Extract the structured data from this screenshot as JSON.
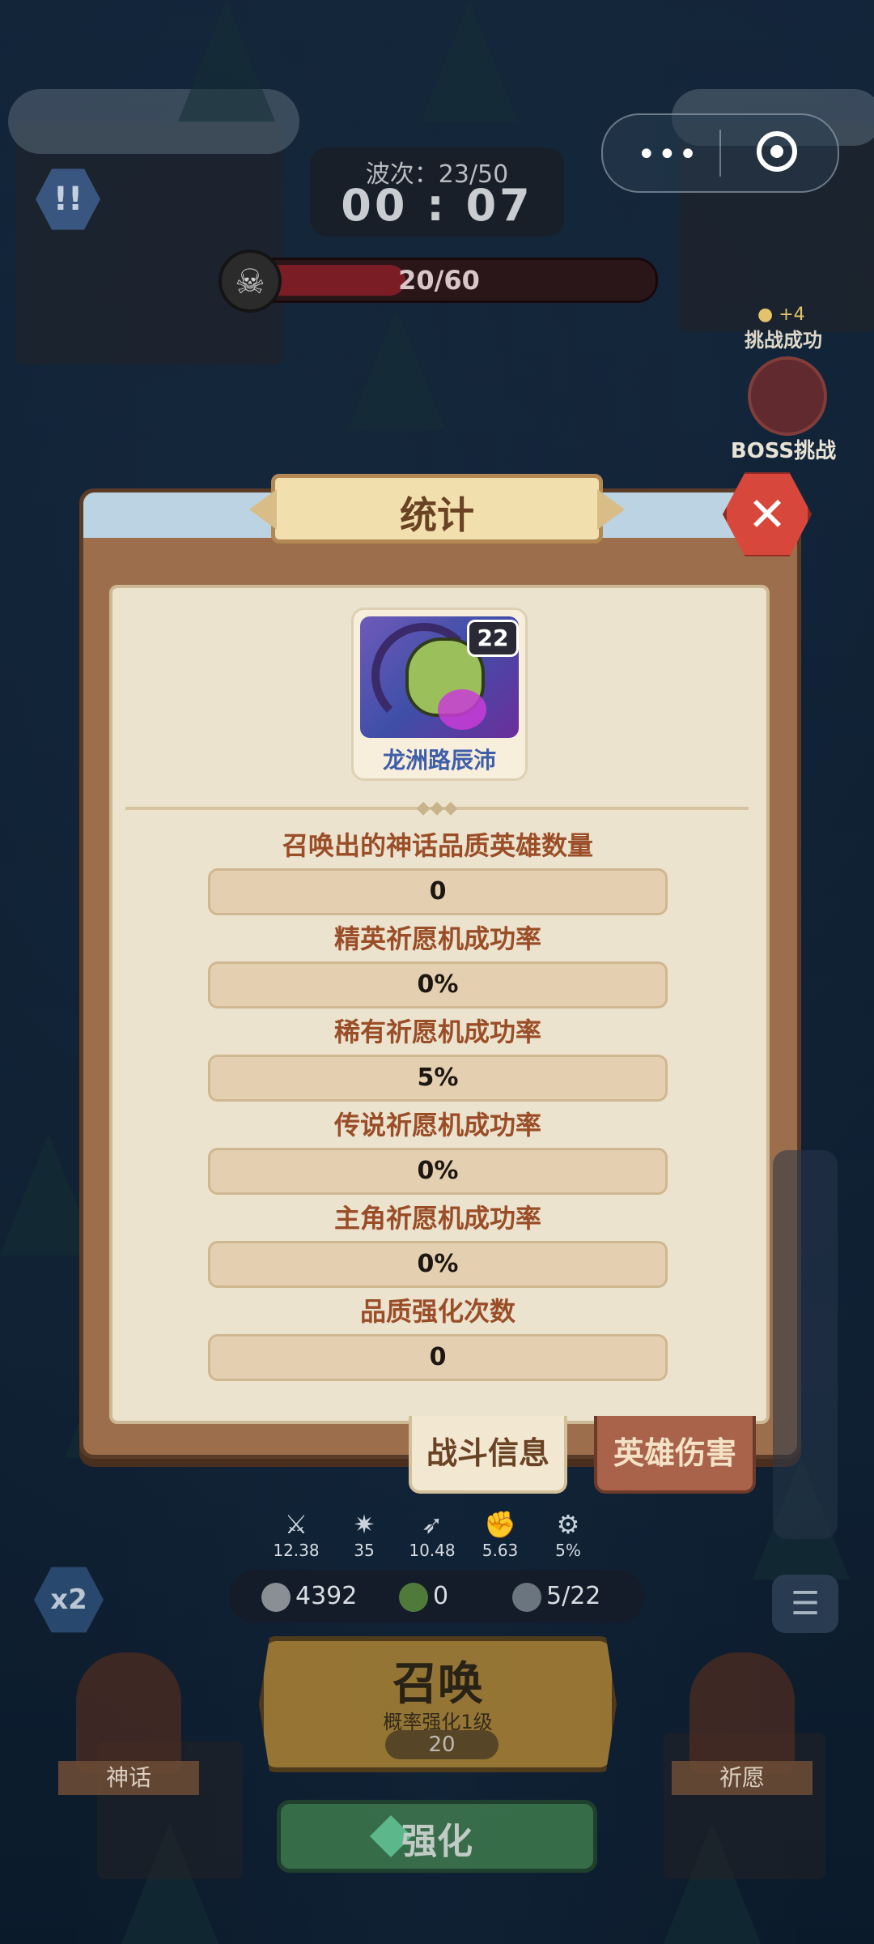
{
  "hud": {
    "wave_label": "波次：23/50",
    "timer": "00 : 07",
    "enemy_count": "20/60",
    "enemy_fill": 0.333,
    "alert_label": "!!",
    "menu_dots": "•••"
  },
  "boss": {
    "reward": "+4",
    "status": "挑战成功",
    "label": "BOSS挑战"
  },
  "dialog": {
    "title": "统计",
    "close_icon": "close-icon",
    "hero": {
      "name": "龙洲路辰沛",
      "level": "22"
    },
    "stats": [
      {
        "label": "召唤出的神话品质英雄数量",
        "value": "0"
      },
      {
        "label": "精英祈愿机成功率",
        "value": "0%"
      },
      {
        "label": "稀有祈愿机成功率",
        "value": "5%"
      },
      {
        "label": "传说祈愿机成功率",
        "value": "0%"
      },
      {
        "label": "主角祈愿机成功率",
        "value": "0%"
      },
      {
        "label": "品质强化次数",
        "value": "0"
      }
    ],
    "tabs": {
      "battle_info": "战斗信息",
      "hero_damage": "英雄伤害"
    }
  },
  "bottom": {
    "mini_stats": [
      "12.38",
      "35",
      "10.48",
      "5.63",
      "5%"
    ],
    "resources": {
      "coins": "4392",
      "clover": "0",
      "units": "5/22"
    },
    "speed": "x2",
    "summon": {
      "title": "召唤",
      "subtitle": "概率强化1级",
      "cost": "20"
    },
    "myth_label": "神话",
    "wish_label": "祈愿",
    "upgrade_label": "强化"
  },
  "colors": {
    "dialog_frame": "#9c6e4b",
    "panel": "#ece3cf",
    "stat_label": "#9a4e28",
    "close": "#d8473b"
  }
}
